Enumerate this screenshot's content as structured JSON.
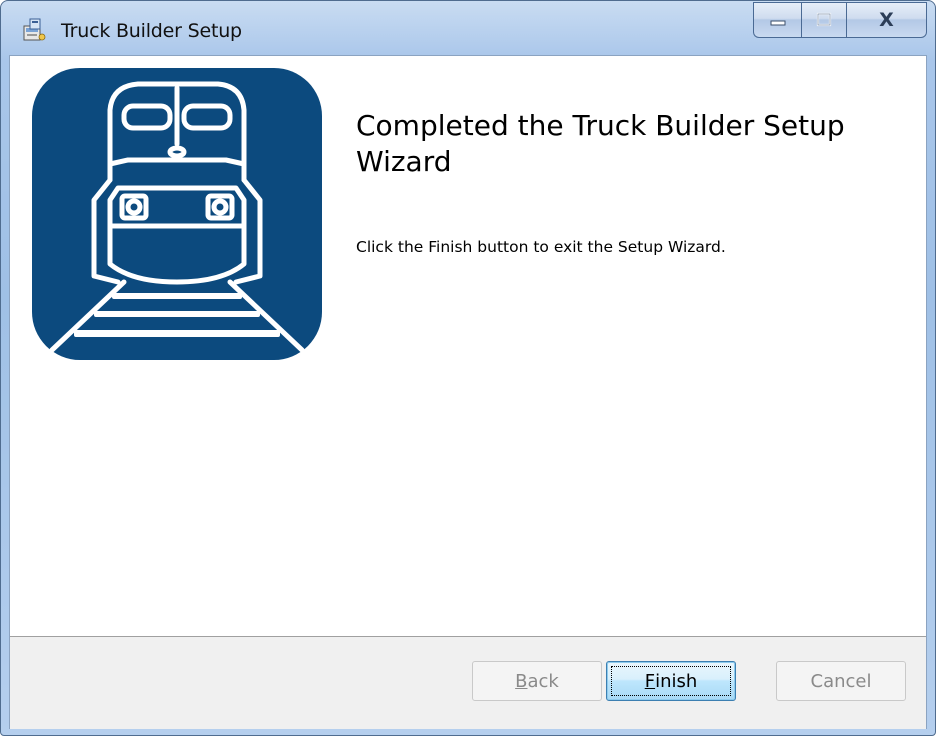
{
  "window": {
    "title": "Truck Builder Setup",
    "icon": "installer-icon"
  },
  "caption_buttons": {
    "minimize": "minimize-icon",
    "maximize": "maximize-icon",
    "close_label": "X"
  },
  "content": {
    "logo": "train-front-logo",
    "heading": "Completed the Truck Builder Setup Wizard",
    "message": "Click the Finish button to exit the Setup Wizard."
  },
  "buttons": {
    "back": {
      "mnemonic": "B",
      "rest": "ack",
      "enabled": false
    },
    "finish": {
      "mnemonic": "F",
      "rest": "inish",
      "enabled": true,
      "default": true
    },
    "cancel": {
      "label": "Cancel",
      "enabled": false
    }
  },
  "colors": {
    "logo_bg": "#0c4a7e",
    "logo_fg": "#ffffff",
    "footer_bg": "#f0f0f0",
    "default_button": "#3c7fb1"
  }
}
